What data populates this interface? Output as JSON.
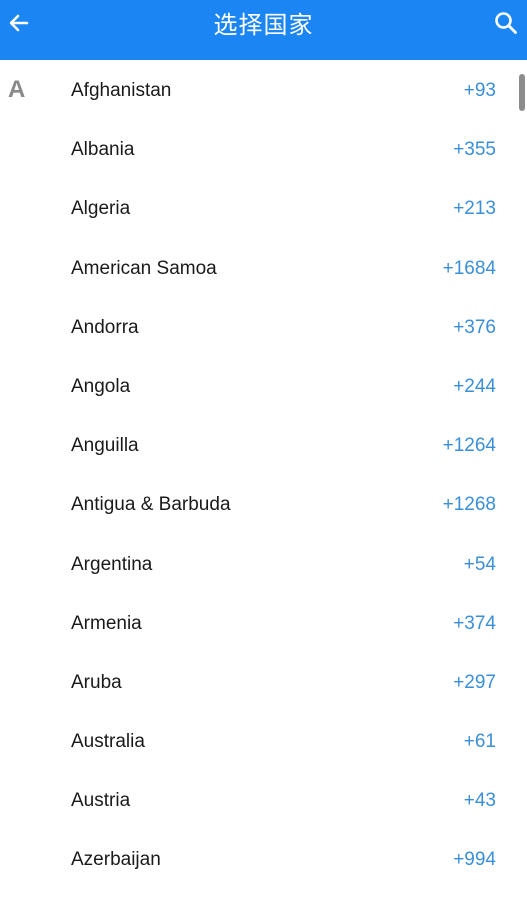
{
  "header": {
    "title": "选择国家",
    "back_icon": "arrow-left-icon",
    "search_icon": "search-icon",
    "background_color": "#1a85f3"
  },
  "section": {
    "letter": "A"
  },
  "colors": {
    "dial_code": "#3a8fd8",
    "country_name": "#1a1a1a",
    "section_letter": "#8a8a8a"
  },
  "countries": [
    {
      "name": "Afghanistan",
      "code": "+93"
    },
    {
      "name": "Albania",
      "code": "+355"
    },
    {
      "name": "Algeria",
      "code": "+213"
    },
    {
      "name": "American Samoa",
      "code": "+1684"
    },
    {
      "name": "Andorra",
      "code": "+376"
    },
    {
      "name": "Angola",
      "code": "+244"
    },
    {
      "name": "Anguilla",
      "code": "+1264"
    },
    {
      "name": "Antigua & Barbuda",
      "code": "+1268"
    },
    {
      "name": "Argentina",
      "code": "+54"
    },
    {
      "name": "Armenia",
      "code": "+374"
    },
    {
      "name": "Aruba",
      "code": "+297"
    },
    {
      "name": "Australia",
      "code": "+61"
    },
    {
      "name": "Austria",
      "code": "+43"
    },
    {
      "name": "Azerbaijan",
      "code": "+994"
    }
  ]
}
